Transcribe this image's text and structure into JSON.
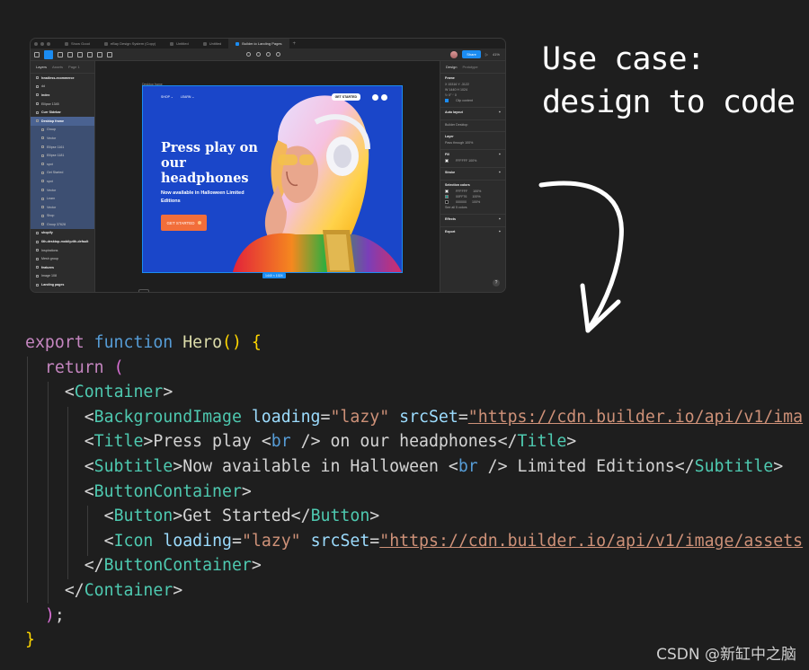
{
  "figma": {
    "tabs": [
      {
        "label": "Show Good"
      },
      {
        "label": "eBay Design System (Copy)"
      },
      {
        "label": "Untitled"
      },
      {
        "label": "Untitled"
      },
      {
        "label": "Builder.io Landing Pages"
      }
    ],
    "toolbar": {
      "share_label": "Share",
      "zoom": "41%"
    },
    "layers_panel": {
      "tab_layers": "Layers",
      "tab_assets": "Assets",
      "page": "Page 1",
      "items": [
        {
          "label": "headless-ecommerce"
        },
        {
          "label": "dd"
        },
        {
          "label": "index"
        },
        {
          "label": "Ellipse 1345"
        },
        {
          "label": "Curr Sidebar"
        },
        {
          "label": "Desktop frame"
        },
        {
          "label": "Group"
        },
        {
          "label": "Vector"
        },
        {
          "label": "Ellipse 1161"
        },
        {
          "label": "Ellipse 1181"
        },
        {
          "label": "spot"
        },
        {
          "label": "Get Started"
        },
        {
          "label": "spot"
        },
        {
          "label": "Vector"
        },
        {
          "label": "Learn"
        },
        {
          "label": "Vector"
        },
        {
          "label": "Shop"
        },
        {
          "label": "Group 37628"
        },
        {
          "label": "shopify"
        },
        {
          "label": "6th-desktop-mobilyzith-default"
        },
        {
          "label": "Inspirations"
        },
        {
          "label": "Mesh group"
        },
        {
          "label": "features"
        },
        {
          "label": "Image 108"
        },
        {
          "label": "Landing pages"
        }
      ]
    },
    "canvas": {
      "frame_label": "Desktop frame",
      "size_badge": "1440 × 1024",
      "hero": {
        "nav": [
          "SHOP ⌄",
          "LEARN ⌄"
        ],
        "top_cta": "GET STARTED",
        "title": "Press play on our headphones",
        "subtitle": "Now available in Halloween Limited Editions",
        "button": "GET STARTED"
      }
    },
    "props_panel": {
      "tab_design": "Design",
      "tab_prototype": "Prototype",
      "frame_head": "Frame",
      "frame_rows": [
        "X 15316  Y -3122",
        "W 1440  H 1024",
        "↻ 0°  ◜ 0"
      ],
      "clip_content": "Clip content",
      "auto_layout": "Auto layout",
      "component": "Builder Desktop",
      "layer_head": "Layer",
      "layer_blend": "Pass through  100%",
      "fill_head": "Fill",
      "fill_row": "FFFFFF  100%",
      "stroke_head": "Stroke",
      "selection_colors_head": "Selection colors",
      "selection_colors": [
        {
          "hex": "FFFFFF",
          "opacity": "100%",
          "swatch": "#ffffff"
        },
        {
          "hex": "00FF76",
          "opacity": "100%",
          "swatch": "#1a9c8b"
        },
        {
          "hex": "000000",
          "opacity": "100%",
          "swatch": "#000000"
        }
      ],
      "see_all": "See all 5 colors",
      "effects_head": "Effects",
      "export_head": "Export",
      "help": "?"
    }
  },
  "note": {
    "line1": "Use case:",
    "line2": "design to code"
  },
  "code": {
    "l1_export": "export",
    "l1_function": "function",
    "l1_name": "Hero",
    "l2_return": "return",
    "container": "Container",
    "background_image": "BackgroundImage",
    "title_tag": "Title",
    "subtitle_tag": "Subtitle",
    "button_container": "ButtonContainer",
    "button_tag": "Button",
    "icon_tag": "Icon",
    "attr_loading": "loading",
    "attr_srcset": "srcSet",
    "val_lazy": "\"lazy\"",
    "url_bg": "\"https://cdn.builder.io/api/v1/ima",
    "url_icon": "\"https://cdn.builder.io/api/v1/image/assets",
    "title_text_1": "Press play ",
    "title_text_2": " on our headphones",
    "subtitle_text_1": "Now available in Halloween ",
    "subtitle_text_2": " Limited Editions",
    "br_tag": "br",
    "button_text": "Get Started"
  },
  "watermark": "CSDN @新缸中之脑"
}
